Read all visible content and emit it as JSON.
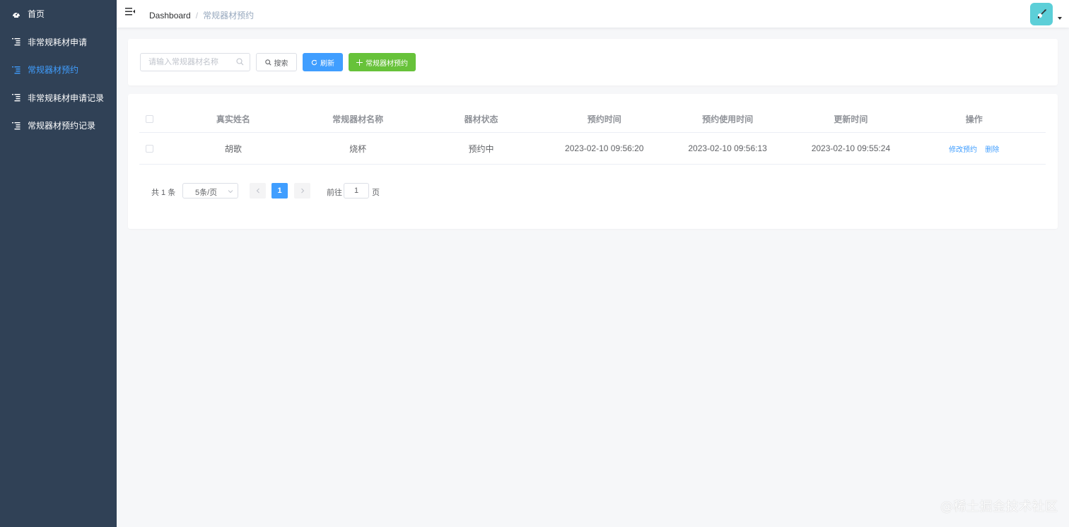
{
  "sidebar": {
    "items": [
      {
        "label": "首页",
        "icon": "dashboard-icon",
        "active": false
      },
      {
        "label": "非常规耗材申请",
        "icon": "list-icon",
        "active": false
      },
      {
        "label": "常规器材预约",
        "icon": "list-icon",
        "active": true
      },
      {
        "label": "非常规耗材申请记录",
        "icon": "list-icon",
        "active": false
      },
      {
        "label": "常规器材预约记录",
        "icon": "list-icon",
        "active": false
      }
    ]
  },
  "header": {
    "breadcrumb_home": "Dashboard",
    "breadcrumb_separator": "/",
    "breadcrumb_current": "常规器材预约"
  },
  "search": {
    "placeholder": "请输入常规器材名称",
    "search_label": "搜索",
    "refresh_label": "刷新",
    "add_label": "常规器材预约"
  },
  "table": {
    "columns": [
      "真实姓名",
      "常规器材名称",
      "器材状态",
      "预约时间",
      "预约使用时间",
      "更新时间",
      "操作"
    ],
    "rows": [
      {
        "name": "胡歌",
        "equipment": "烧杯",
        "status": "预约中",
        "reserve_time": "2023-02-10 09:56:20",
        "use_time": "2023-02-10 09:56:13",
        "update_time": "2023-02-10 09:55:24",
        "edit_label": "修改预约",
        "delete_label": "删除"
      }
    ]
  },
  "pagination": {
    "total_text": "共 1 条",
    "page_size": "5条/页",
    "current_page": "1",
    "goto_label": "前往",
    "goto_value": "1",
    "page_unit": "页"
  },
  "watermark": "@稀土掘金技术社区",
  "colors": {
    "sidebar_bg": "#304156",
    "primary": "#409eff",
    "success": "#67c23a",
    "avatar_bg": "#5ccfd8"
  }
}
